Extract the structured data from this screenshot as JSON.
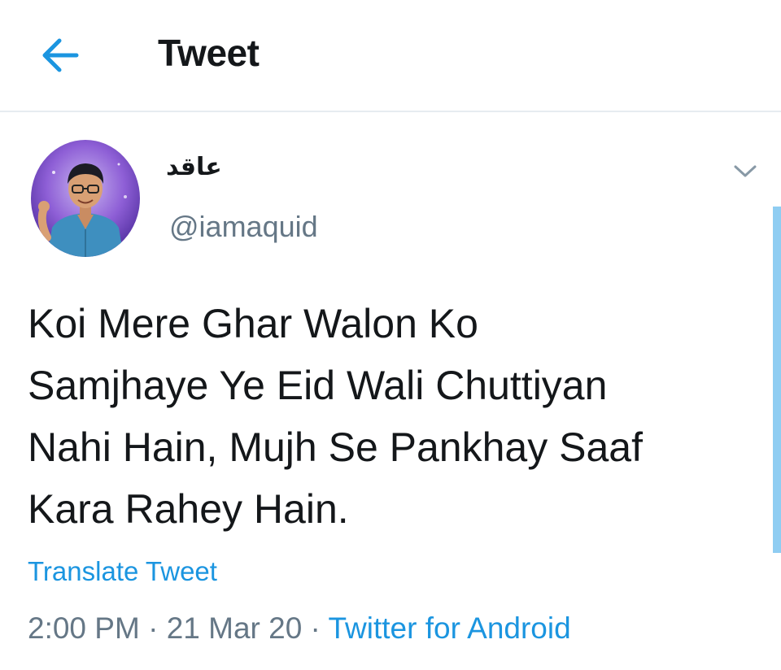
{
  "header": {
    "back_icon": "arrow-left-icon",
    "title": "Tweet"
  },
  "tweet": {
    "avatar_icon": "user-avatar-illustration",
    "display_name": "عاقد",
    "handle": "@iamaquid",
    "menu_icon": "chevron-down-icon",
    "lines": [
      "Koi Mere Ghar Walon Ko",
      "Samjhaye Ye Eid Wali Chuttiyan",
      "Nahi Hain, Mujh Se Pankhay Saaf",
      "Kara Rahey Hain."
    ],
    "translate_label": "Translate Tweet",
    "time": "2:00 PM",
    "date": "21 Mar 20",
    "separator": " · ",
    "source": "Twitter for Android"
  },
  "colors": {
    "accent": "#1b95e0",
    "text_primary": "#14171a",
    "text_secondary": "#657786",
    "divider": "#e6ecf0",
    "scroll_indicator": "#8fcdf2"
  }
}
